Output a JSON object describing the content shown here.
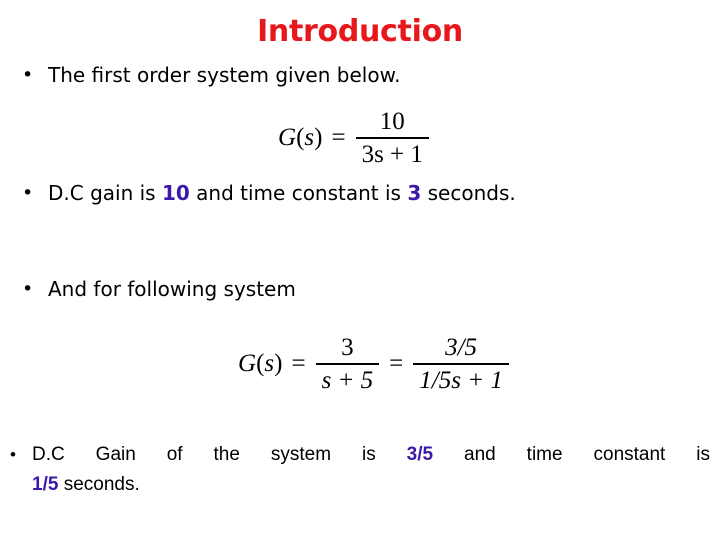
{
  "slide": {
    "background_color": "#ffffff",
    "title": "Introduction",
    "title_color": "#e8171b",
    "highlight_color": "#3c19a8",
    "text_color": "#000000",
    "bullet_marker": "•"
  },
  "bullets": [
    {
      "id": "bullet-1",
      "marker": "•",
      "text": "The first order system given below."
    },
    {
      "id": "bullet-2",
      "marker": "•",
      "prefix": "D.C gain is ",
      "highlight_1": "10",
      "middle": " and time constant is ",
      "highlight_2": "3",
      "suffix": " seconds."
    },
    {
      "id": "bullet-3",
      "marker": "•",
      "text": "And for following system"
    },
    {
      "id": "bullet-4",
      "marker": "•",
      "line1_prefix": "D.C Gain of the system is ",
      "line1_highlight": "3/5",
      "line1_suffix": " and time constant is",
      "line2_highlight": "1/5",
      "line2_suffix": " seconds."
    }
  ],
  "equations": [
    {
      "id": "equation-1",
      "lhs": "G(s)",
      "operator": "=",
      "numerator": "10",
      "denominator": "3s + 1",
      "plain_text": "G(s) = 10 / (3s + 1)"
    },
    {
      "id": "equation-2",
      "lhs": "G(s)",
      "operator_1": "=",
      "numerator_1": "3",
      "denominator_1": "s + 5",
      "operator_2": "=",
      "numerator_2": "3/5",
      "denominator_2": "1/5s + 1",
      "plain_text": "G(s) = 3 / (s + 5) = (3/5) / (1/5 s + 1)"
    }
  ]
}
